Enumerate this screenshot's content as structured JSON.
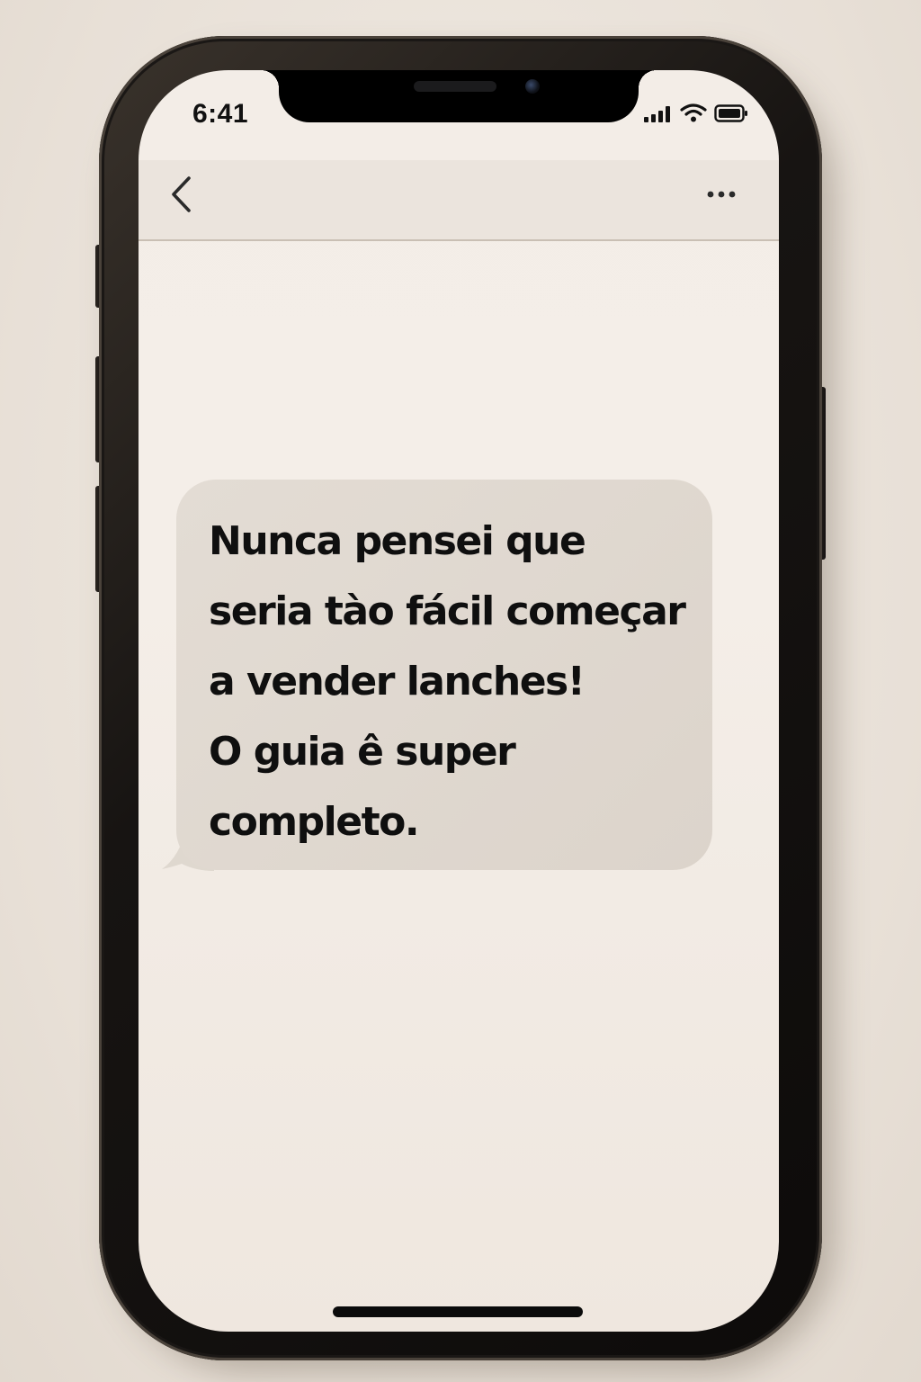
{
  "status_bar": {
    "time": "6:41",
    "icons": [
      "cellular-signal-icon",
      "wifi-icon",
      "battery-icon"
    ]
  },
  "header": {
    "back_icon": "chevron-left-icon",
    "more_icon": "more-horizontal-icon"
  },
  "conversation": {
    "messages": [
      {
        "direction": "incoming",
        "lines": [
          "Nunca pensei que",
          "seria tào fácil começar",
          "a vender lanches!",
          "O guia ê super",
          "completo."
        ]
      }
    ]
  },
  "colors": {
    "screen_bg": "#f3ede7",
    "header_bg": "#ebe4dd",
    "bubble_bg": "#e0d9d0",
    "text": "#0f0f0f",
    "device_frame": "#171412"
  }
}
